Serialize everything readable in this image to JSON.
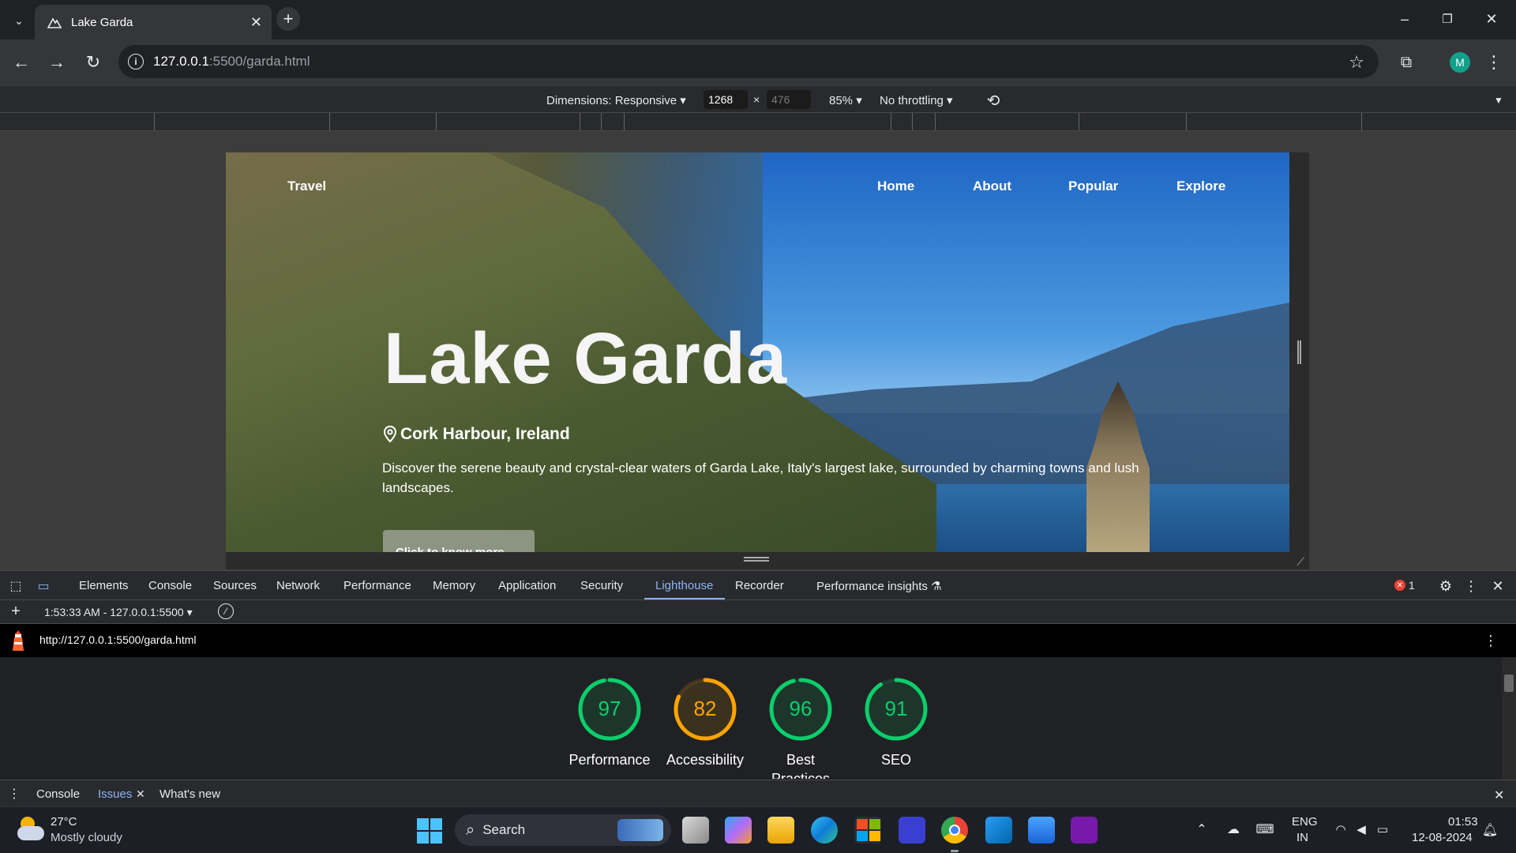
{
  "browser": {
    "tab_title": "Lake Garda",
    "url_host": "127.0.0.1",
    "url_rest": ":5500/garda.html"
  },
  "device_toolbar": {
    "dimensions_label": "Dimensions: Responsive",
    "width": "1268",
    "height": "476",
    "zoom": "85%",
    "throttling": "No throttling"
  },
  "site": {
    "brand": "Travel",
    "nav": [
      "Home",
      "About",
      "Popular",
      "Explore"
    ],
    "title": "Lake Garda",
    "location": "Cork Harbour, Ireland",
    "description": "Discover the serene beauty and crystal-clear waters of Garda Lake, Italy's largest lake, surrounded by charming towns and lush landscapes.",
    "button": "Click to know more"
  },
  "devtools": {
    "tabs": [
      "Elements",
      "Console",
      "Sources",
      "Network",
      "Performance",
      "Memory",
      "Application",
      "Security",
      "Lighthouse",
      "Recorder",
      "Performance insights"
    ],
    "active_tab": "Lighthouse",
    "error_count": "1",
    "report_selector": "1:53:33 AM - 127.0.0.1:5500",
    "report_url": "http://127.0.0.1:5500/garda.html",
    "scores": [
      {
        "label": "Performance",
        "value": 97,
        "color": "#0cce6b"
      },
      {
        "label": "Accessibility",
        "value": 82,
        "color": "#ffa400"
      },
      {
        "label": "Best Practices",
        "value": 96,
        "color": "#0cce6b"
      },
      {
        "label": "SEO",
        "value": 91,
        "color": "#0cce6b"
      }
    ],
    "drawer_tabs": [
      "Console",
      "Issues",
      "What's new"
    ]
  },
  "taskbar": {
    "weather_temp": "27°C",
    "weather_desc": "Mostly cloudy",
    "search_label": "Search",
    "lang_top": "ENG",
    "lang_bottom": "IN",
    "time": "01:53",
    "date": "12-08-2024"
  }
}
